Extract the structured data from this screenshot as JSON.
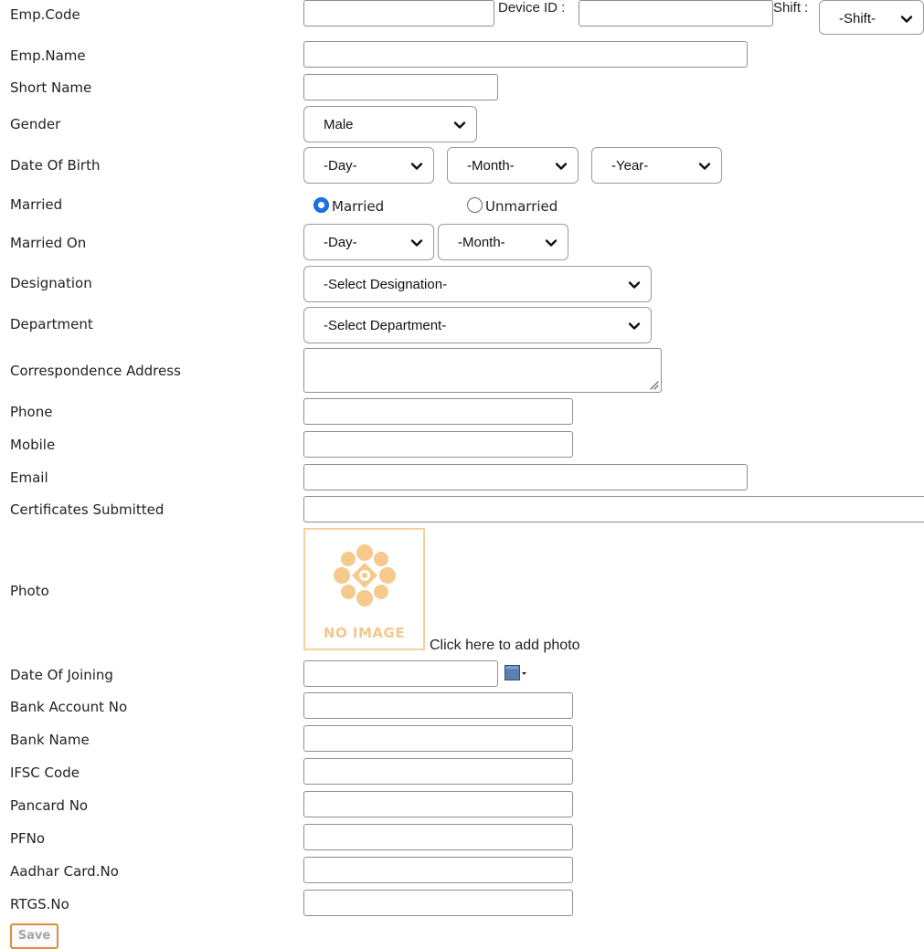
{
  "labels": {
    "emp_code": "Emp.Code",
    "emp_name": "Emp.Name",
    "short_name": "Short Name",
    "gender": "Gender",
    "dob": "Date Of Birth",
    "married": "Married",
    "married_on": "Married On",
    "designation": "Designation",
    "department": "Department",
    "address": "Correspondence Address",
    "phone": "Phone",
    "mobile": "Mobile",
    "email": "Email",
    "certificates": "Certificates Submitted",
    "photo": "Photo",
    "doj": "Date Of Joining",
    "bank_account": "Bank Account No",
    "bank_name": "Bank Name",
    "ifsc": "IFSC Code",
    "pancard": "Pancard No",
    "pfno": "PFNo",
    "aadhar": "Aadhar Card.No",
    "rtgs": "RTGS.No",
    "device_id": "Device ID :",
    "shift": "Shift :"
  },
  "fields": {
    "emp_code": "",
    "device_id": "",
    "emp_name": "",
    "short_name": "",
    "phone": "",
    "mobile": "",
    "email": "",
    "certificates": "",
    "doj": "",
    "bank_account": "",
    "bank_name": "",
    "ifsc": "",
    "pancard": "",
    "pfno": "",
    "aadhar": "",
    "rtgs": "",
    "address": ""
  },
  "selects": {
    "shift": "-Shift-",
    "gender": "Male",
    "dob_day": "-Day-",
    "dob_month": "-Month-",
    "dob_year": "-Year-",
    "married_day": "-Day-",
    "married_month": "-Month-",
    "designation": "-Select Designation-",
    "department": "-Select Department-"
  },
  "radios": {
    "married_label": "Married",
    "unmarried_label": "Unmarried",
    "selected": "Married"
  },
  "photo": {
    "placeholder_text": "NO IMAGE",
    "add_link": "Click here to add photo"
  },
  "buttons": {
    "save": "Save"
  },
  "colors": {
    "radio_selected": "#1a73e8",
    "photo_placeholder": "#f4c88c",
    "save_border": "#e08b3d",
    "calendar_icon": "#5a7fb0"
  },
  "icons": {
    "select_arrow": "chevron-down-icon",
    "calendar": "calendar-icon",
    "photo_placeholder": "flower-icon",
    "resize_handle": "resize-grip-icon"
  }
}
